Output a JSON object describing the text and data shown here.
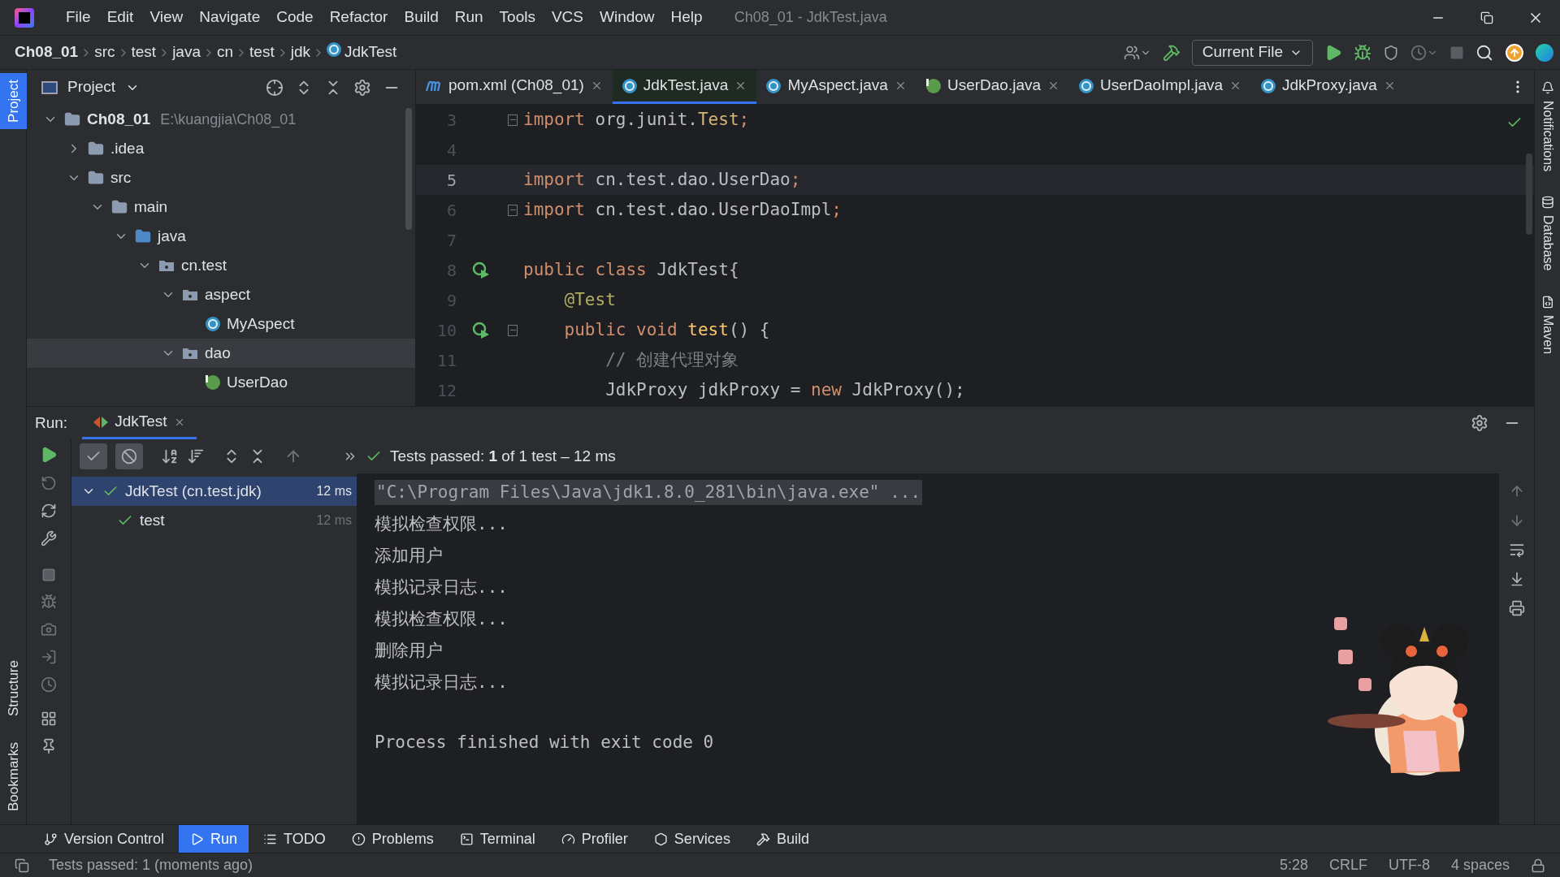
{
  "window": {
    "title": "Ch08_01 - JdkTest.java",
    "menu": [
      "File",
      "Edit",
      "View",
      "Navigate",
      "Code",
      "Refactor",
      "Build",
      "Run",
      "Tools",
      "VCS",
      "Window",
      "Help"
    ]
  },
  "breadcrumbs": [
    {
      "label": "Ch08_01",
      "kind": "project"
    },
    {
      "label": "src",
      "kind": "dir"
    },
    {
      "label": "test",
      "kind": "dir"
    },
    {
      "label": "java",
      "kind": "dir"
    },
    {
      "label": "cn",
      "kind": "dir"
    },
    {
      "label": "test",
      "kind": "dir"
    },
    {
      "label": "jdk",
      "kind": "dir"
    },
    {
      "label": "JdkTest",
      "kind": "class"
    }
  ],
  "toolbar": {
    "run_config": "Current File"
  },
  "left_stripe": {
    "top": [
      {
        "label": "Project",
        "selected": true
      }
    ],
    "bottom": [
      {
        "label": "Structure",
        "selected": false
      },
      {
        "label": "Bookmarks",
        "selected": false
      }
    ]
  },
  "right_stripe": [
    {
      "label": "Notifications",
      "kind": "bell"
    },
    {
      "label": "Database",
      "kind": "database"
    },
    {
      "label": "Maven",
      "kind": "maven"
    }
  ],
  "project_panel": {
    "title": "Project",
    "tree": [
      {
        "label": "Ch08_01",
        "hint": "E:\\kuangjia\\Ch08_01",
        "kind": "module",
        "expanded": true,
        "selected": false,
        "children": [
          {
            "label": ".idea",
            "kind": "folder",
            "expanded": false,
            "selected": false
          },
          {
            "label": "src",
            "kind": "folder",
            "expanded": true,
            "selected": false,
            "children": [
              {
                "label": "main",
                "kind": "folder",
                "expanded": true,
                "selected": false,
                "children": [
                  {
                    "label": "java",
                    "kind": "source",
                    "expanded": true,
                    "selected": false,
                    "children": [
                      {
                        "label": "cn.test",
                        "kind": "package",
                        "expanded": true,
                        "selected": false,
                        "children": [
                          {
                            "label": "aspect",
                            "kind": "package",
                            "expanded": true,
                            "selected": false,
                            "children": [
                              {
                                "label": "MyAspect",
                                "kind": "class",
                                "selected": false
                              }
                            ]
                          },
                          {
                            "label": "dao",
                            "kind": "package",
                            "expanded": true,
                            "selected": true,
                            "children": [
                              {
                                "label": "UserDao",
                                "kind": "interface",
                                "selected": false
                              }
                            ]
                          }
                        ]
                      }
                    ]
                  }
                ]
              }
            ]
          }
        ]
      }
    ]
  },
  "editor": {
    "tabs": [
      {
        "label": "pom.xml (Ch08_01)",
        "kind": "maven",
        "selected": false
      },
      {
        "label": "JdkTest.java",
        "kind": "class",
        "selected": true
      },
      {
        "label": "MyAspect.java",
        "kind": "class",
        "selected": false
      },
      {
        "label": "UserDao.java",
        "kind": "interface",
        "selected": false
      },
      {
        "label": "UserDaoImpl.java",
        "kind": "class",
        "selected": false
      },
      {
        "label": "JdkProxy.java",
        "kind": "class",
        "selected": false
      }
    ],
    "lines": [
      {
        "number": "3",
        "current": false,
        "run": false,
        "fold": true,
        "tokens": [
          {
            "kind": "keyword",
            "text": "import "
          },
          {
            "kind": "plain",
            "text": "org.junit."
          },
          {
            "kind": "type",
            "text": "Test"
          },
          {
            "kind": "keyword",
            "text": ";"
          }
        ]
      },
      {
        "number": "4",
        "current": false,
        "run": false,
        "fold": false
      },
      {
        "number": "5",
        "current": true,
        "run": false,
        "fold": false,
        "tokens": [
          {
            "kind": "keyword",
            "text": "import "
          },
          {
            "kind": "plain",
            "text": "cn.test.dao.UserDao"
          },
          {
            "kind": "keyword",
            "text": ";"
          }
        ]
      },
      {
        "number": "6",
        "current": false,
        "run": false,
        "fold": true,
        "tokens": [
          {
            "kind": "keyword",
            "text": "import "
          },
          {
            "kind": "plain",
            "text": "cn.test.dao.UserDaoImpl"
          },
          {
            "kind": "keyword",
            "text": ";"
          }
        ]
      },
      {
        "number": "7",
        "current": false,
        "run": false,
        "fold": false
      },
      {
        "number": "8",
        "current": false,
        "run": true,
        "fold": false,
        "tokens": [
          {
            "kind": "keyword",
            "text": "public class "
          },
          {
            "kind": "plain",
            "text": "JdkTest{"
          }
        ]
      },
      {
        "number": "9",
        "current": false,
        "run": false,
        "fold": false,
        "tokens": [
          {
            "kind": "annotation",
            "text": "    @Test"
          }
        ]
      },
      {
        "number": "10",
        "current": false,
        "run": true,
        "fold": true,
        "tokens": [
          {
            "kind": "keyword",
            "text": "    public void "
          },
          {
            "kind": "method",
            "text": "test"
          },
          {
            "kind": "plain",
            "text": "() {"
          }
        ]
      },
      {
        "number": "11",
        "current": false,
        "run": false,
        "fold": false,
        "tokens": [
          {
            "kind": "comment",
            "text": "        // 创建代理对象"
          }
        ]
      },
      {
        "number": "12",
        "current": false,
        "run": false,
        "fold": false,
        "tokens": [
          {
            "kind": "plain",
            "text": "        JdkProxy jdkProxy = "
          },
          {
            "kind": "keyword",
            "text": "new "
          },
          {
            "kind": "plain",
            "text": "JdkProxy();"
          }
        ]
      }
    ]
  },
  "run_panel": {
    "label": "Run:",
    "tab": "JdkTest",
    "filters": {
      "show_passed": true,
      "show_ignored": true
    },
    "status": "Tests passed: **1** of 1 test – 12 ms",
    "tests": [
      {
        "label": "JdkTest (cn.test.jdk)",
        "time": "12 ms",
        "passed": true,
        "selected": true,
        "expanded": true,
        "children": [
          {
            "label": "test",
            "time": "12 ms",
            "passed": true,
            "selected": false
          }
        ]
      }
    ],
    "console": [
      {
        "text": "\"C:\\Program Files\\Java\\jdk1.8.0_281\\bin\\java.exe\" ...",
        "kind": "command",
        "gap_before": false
      },
      {
        "text": "模拟检查权限...",
        "kind": "output",
        "gap_before": false
      },
      {
        "text": "添加用户",
        "kind": "output",
        "gap_before": false
      },
      {
        "text": "模拟记录日志...",
        "kind": "output",
        "gap_before": false
      },
      {
        "text": "模拟检查权限...",
        "kind": "output",
        "gap_before": false
      },
      {
        "text": "删除用户",
        "kind": "output",
        "gap_before": false
      },
      {
        "text": "模拟记录日志...",
        "kind": "output",
        "gap_before": false
      },
      {
        "text": "Process finished with exit code 0",
        "kind": "output",
        "gap_before": true
      }
    ]
  },
  "tool_tabs": [
    {
      "label": "Version Control",
      "kind": "vcs",
      "selected": false
    },
    {
      "label": "Run",
      "kind": "run",
      "selected": true
    },
    {
      "label": "TODO",
      "kind": "todo",
      "selected": false
    },
    {
      "label": "Problems",
      "kind": "problems",
      "selected": false
    },
    {
      "label": "Terminal",
      "kind": "terminal",
      "selected": false
    },
    {
      "label": "Profiler",
      "kind": "profiler",
      "selected": false
    },
    {
      "label": "Services",
      "kind": "services",
      "selected": false
    },
    {
      "label": "Build",
      "kind": "build",
      "selected": false
    }
  ],
  "status_bar": {
    "message": "Tests passed: 1 (moments ago)",
    "items": [
      "5:28",
      "CRLF",
      "UTF-8",
      "4 spaces"
    ]
  }
}
